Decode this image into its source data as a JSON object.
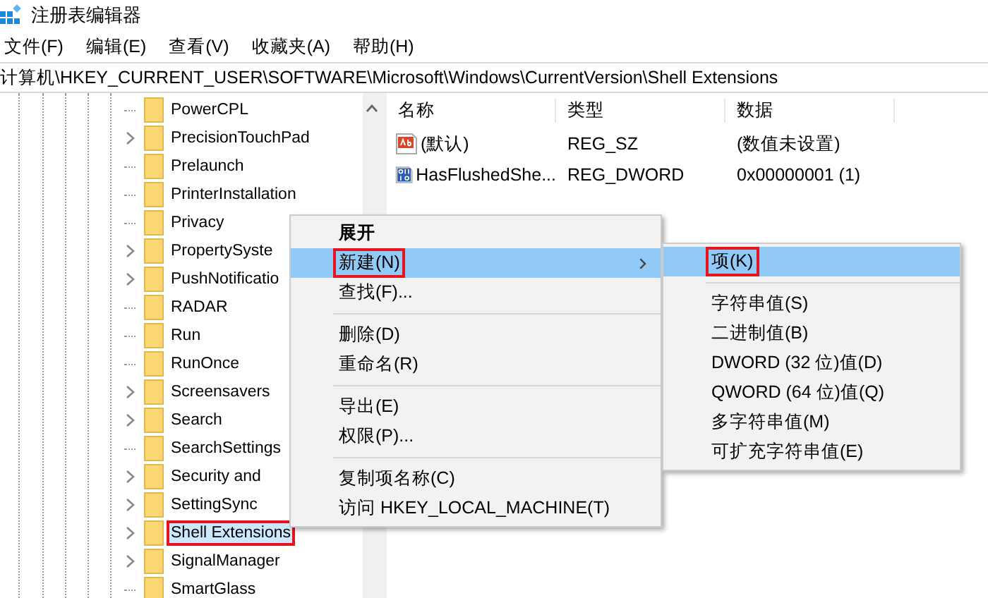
{
  "window": {
    "title": "注册表编辑器"
  },
  "menu_bar": [
    "文件(F)",
    "编辑(E)",
    "查看(V)",
    "收藏夹(A)",
    "帮助(H)"
  ],
  "address_bar": {
    "value": "计算机\\HKEY_CURRENT_USER\\SOFTWARE\\Microsoft\\Windows\\CurrentVersion\\Shell Extensions"
  },
  "tree": {
    "items": [
      {
        "label": "PowerCPL",
        "has_children": false,
        "selected": false,
        "annotated": false
      },
      {
        "label": "PrecisionTouchPad",
        "has_children": true,
        "selected": false,
        "annotated": false
      },
      {
        "label": "Prelaunch",
        "has_children": false,
        "selected": false,
        "annotated": false
      },
      {
        "label": "PrinterInstallation",
        "has_children": false,
        "selected": false,
        "annotated": false
      },
      {
        "label": "Privacy",
        "has_children": false,
        "selected": false,
        "annotated": false
      },
      {
        "label": "PropertySyste",
        "has_children": true,
        "selected": false,
        "annotated": false
      },
      {
        "label": "PushNotificatio",
        "has_children": true,
        "selected": false,
        "annotated": false
      },
      {
        "label": "RADAR",
        "has_children": false,
        "selected": false,
        "annotated": false
      },
      {
        "label": "Run",
        "has_children": false,
        "selected": false,
        "annotated": false
      },
      {
        "label": "RunOnce",
        "has_children": false,
        "selected": false,
        "annotated": false
      },
      {
        "label": "Screensavers",
        "has_children": true,
        "selected": false,
        "annotated": false
      },
      {
        "label": "Search",
        "has_children": true,
        "selected": false,
        "annotated": false
      },
      {
        "label": "SearchSettings",
        "has_children": false,
        "selected": false,
        "annotated": false
      },
      {
        "label": "Security and",
        "has_children": true,
        "selected": false,
        "annotated": false
      },
      {
        "label": "SettingSync",
        "has_children": true,
        "selected": false,
        "annotated": false
      },
      {
        "label": "Shell Extensions",
        "has_children": true,
        "selected": true,
        "annotated": true
      },
      {
        "label": "SignalManager",
        "has_children": true,
        "selected": false,
        "annotated": false
      },
      {
        "label": "SmartGlass",
        "has_children": false,
        "selected": false,
        "annotated": false
      }
    ]
  },
  "values_table": {
    "columns": [
      "名称",
      "类型",
      "数据"
    ],
    "rows": [
      {
        "kind": "string",
        "name": "(默认)",
        "type": "REG_SZ",
        "data": "(数值未设置)"
      },
      {
        "kind": "binary",
        "name": "HasFlushedShe...",
        "type": "REG_DWORD",
        "data": "0x00000001 (1)"
      }
    ]
  },
  "context_menu": {
    "items": [
      {
        "kind": "item",
        "label": "展开",
        "bold": true,
        "selected": false,
        "has_submenu": false,
        "annotated": false
      },
      {
        "kind": "item",
        "label": "新建(N)",
        "bold": false,
        "selected": true,
        "has_submenu": true,
        "annotated": true
      },
      {
        "kind": "item",
        "label": "查找(F)...",
        "bold": false,
        "selected": false,
        "has_submenu": false,
        "annotated": false
      },
      {
        "kind": "separator"
      },
      {
        "kind": "item",
        "label": "删除(D)",
        "bold": false,
        "selected": false,
        "has_submenu": false,
        "annotated": false
      },
      {
        "kind": "item",
        "label": "重命名(R)",
        "bold": false,
        "selected": false,
        "has_submenu": false,
        "annotated": false
      },
      {
        "kind": "separator"
      },
      {
        "kind": "item",
        "label": "导出(E)",
        "bold": false,
        "selected": false,
        "has_submenu": false,
        "annotated": false
      },
      {
        "kind": "item",
        "label": "权限(P)...",
        "bold": false,
        "selected": false,
        "has_submenu": false,
        "annotated": false
      },
      {
        "kind": "separator"
      },
      {
        "kind": "item",
        "label": "复制项名称(C)",
        "bold": false,
        "selected": false,
        "has_submenu": false,
        "annotated": false
      },
      {
        "kind": "item",
        "label": "访问 HKEY_LOCAL_MACHINE(T)",
        "bold": false,
        "selected": false,
        "has_submenu": false,
        "annotated": false
      }
    ]
  },
  "submenu": {
    "items": [
      {
        "kind": "item",
        "label": "项(K)",
        "selected": true,
        "annotated": true
      },
      {
        "kind": "separator"
      },
      {
        "kind": "item",
        "label": "字符串值(S)",
        "selected": false,
        "annotated": false
      },
      {
        "kind": "item",
        "label": "二进制值(B)",
        "selected": false,
        "annotated": false
      },
      {
        "kind": "item",
        "label": "DWORD (32 位)值(D)",
        "selected": false,
        "annotated": false
      },
      {
        "kind": "item",
        "label": "QWORD (64 位)值(Q)",
        "selected": false,
        "annotated": false
      },
      {
        "kind": "item",
        "label": "多字符串值(M)",
        "selected": false,
        "annotated": false
      },
      {
        "kind": "item",
        "label": "可扩充字符串值(E)",
        "selected": false,
        "annotated": false
      }
    ]
  }
}
